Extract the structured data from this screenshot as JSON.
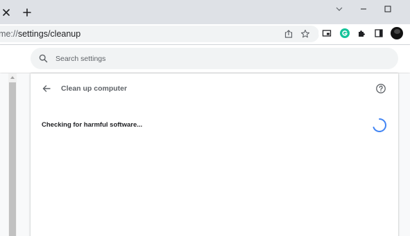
{
  "browser": {
    "tab_close_icon": "close-icon",
    "new_tab_icon": "plus-icon",
    "window_controls": [
      "chevron-down-icon",
      "minimize-icon",
      "maximize-icon"
    ]
  },
  "toolbar": {
    "url_scheme": "hrome://",
    "url_path": "settings/cleanup",
    "icons": [
      "share-icon",
      "star-icon",
      "picture-in-picture-icon",
      "grammarly-icon",
      "puzzle-icon",
      "side-panel-icon",
      "avatar"
    ]
  },
  "search": {
    "placeholder": "Search settings"
  },
  "cleanup": {
    "title": "Clean up computer",
    "status": "Checking for harmful software..."
  },
  "colors": {
    "spinner": "#4285f4",
    "grammarly": "#15c39a"
  }
}
